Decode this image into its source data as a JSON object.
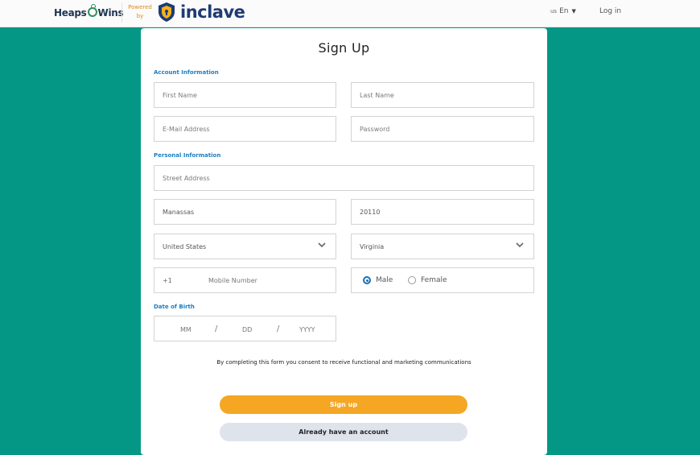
{
  "header": {
    "brand": "Heaps",
    "brand_suffix": "Wins",
    "powered_by_1": "Powered",
    "powered_by_2": "by",
    "partner": "inclave",
    "lang_code": "us",
    "lang_label": "En",
    "login": "Log in"
  },
  "form": {
    "title": "Sign Up",
    "sections": {
      "account": "Account Information",
      "personal": "Personal Information",
      "dob": "Date of Birth"
    },
    "first_name": {
      "placeholder": "First Name",
      "value": ""
    },
    "last_name": {
      "placeholder": "Last Name",
      "value": ""
    },
    "email": {
      "placeholder": "E-Mail Address",
      "value": ""
    },
    "password": {
      "placeholder": "Password",
      "value": ""
    },
    "street": {
      "placeholder": "Street Address",
      "value": ""
    },
    "city": {
      "value": "Manassas"
    },
    "zip": {
      "value": "20110"
    },
    "country": {
      "selected": "United States"
    },
    "state": {
      "selected": "Virginia"
    },
    "phone": {
      "country_code": "+1",
      "placeholder": "Mobile Number"
    },
    "gender": {
      "male": "Male",
      "female": "Female",
      "selected": "Male"
    },
    "dob": {
      "mm": "MM",
      "dd": "DD",
      "yyyy": "YYYY",
      "sep": "/"
    },
    "consent": "By completing this form you consent to receive functional and marketing communications",
    "signup_button": "Sign up",
    "login_button": "Already have an account"
  },
  "colors": {
    "background": "#059786",
    "accent": "#f5a623",
    "section_label": "#1a7ec4",
    "radio_selected": "#1570b8"
  }
}
